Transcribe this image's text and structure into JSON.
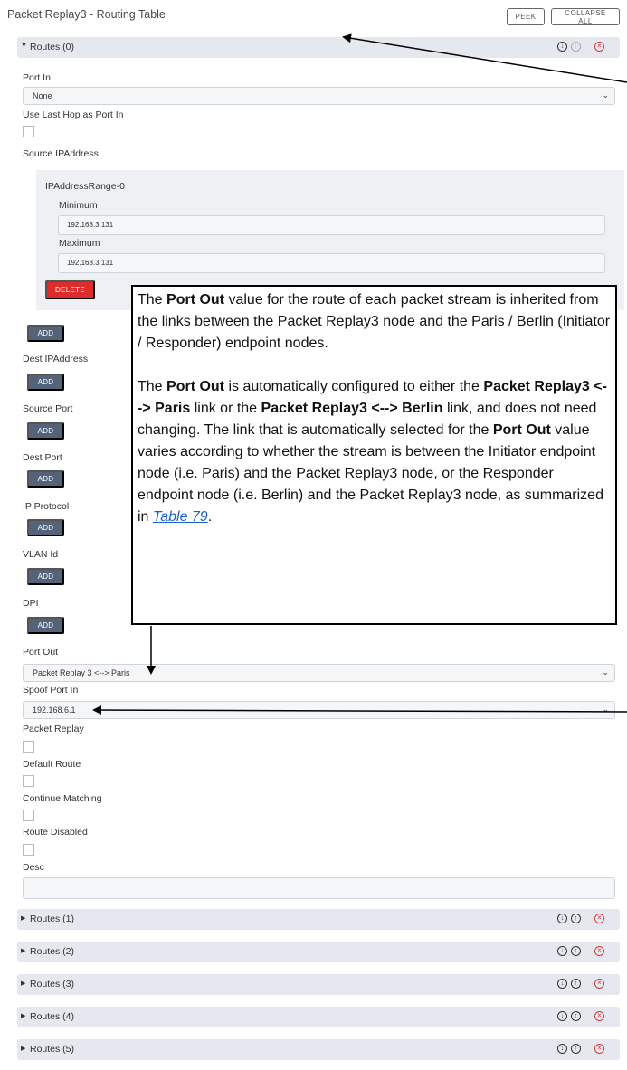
{
  "header": {
    "title": "Packet Replay3 - Routing Table",
    "peek": "PEEK",
    "collapse_all": "COLLAPSE ALL"
  },
  "route0": {
    "label": "Routes (0)",
    "port_in_label": "Port In",
    "port_in_value": "None",
    "use_last_hop_label": "Use Last Hop as Port In",
    "source_ip_label": "Source IPAddress",
    "range_label": "IPAddressRange-0",
    "minimum_label": "Minimum",
    "minimum_value": "192.168.3.131",
    "maximum_label": "Maximum",
    "maximum_value": "192.168.3.131",
    "delete": "DELETE",
    "add": "ADD",
    "dest_ip_label": "Dest IPAddress",
    "source_port_label": "Source Port",
    "dest_port_label": "Dest Port",
    "ip_protocol_label": "IP Protocol",
    "vlan_label": "VLAN Id",
    "dpi_label": "DPI",
    "port_out_label": "Port Out",
    "port_out_value": "Packet Replay 3 <--> Paris",
    "spoof_label": "Spoof Port In",
    "spoof_value": "192.168.6.1",
    "packet_replay_label": "Packet Replay",
    "default_route_label": "Default Route",
    "continue_label": "Continue Matching",
    "disabled_label": "Route Disabled",
    "desc_label": "Desc"
  },
  "routes_collapsed": [
    "Routes (1)",
    "Routes (2)",
    "Routes (3)",
    "Routes (4)",
    "Routes (5)"
  ],
  "callout": {
    "p1_a": "The ",
    "p1_b": "Port Out",
    "p1_c": " value for the route of each packet stream is inherited from the links between the Packet Replay3 node and the Paris / Berlin (Initiator / Responder) endpoint nodes.",
    "p2_a": "The ",
    "p2_b": "Port Out",
    "p2_c": " is automatically configured to either the ",
    "p2_d": "Packet Replay3 <--> Paris",
    "p2_e": " link or the ",
    "p2_f": "Packet Replay3 <--> Berlin",
    "p2_g": " link, and does not need changing. The link that is automatically selected for the ",
    "p2_h": "Port Out",
    "p2_i": " value varies according to whether the stream is between the Initiator endpoint node (i.e. Paris) and the Packet Replay3 node, or the Responder endpoint node (i.e. Berlin) and the Packet Replay3 node, as summarized in ",
    "p2_link": "Table 79",
    "p2_end": "."
  },
  "icons": {
    "down": "arrow-down-circle-icon",
    "up": "arrow-up-circle-icon",
    "remove": "x-circle-icon",
    "chevron": "chevron-down-icon"
  },
  "colors": {
    "add_button": "#53647a",
    "delete_button": "#e02b2b",
    "route_bar": "#e5e8ee",
    "remove_icon": "#d83b3b"
  }
}
